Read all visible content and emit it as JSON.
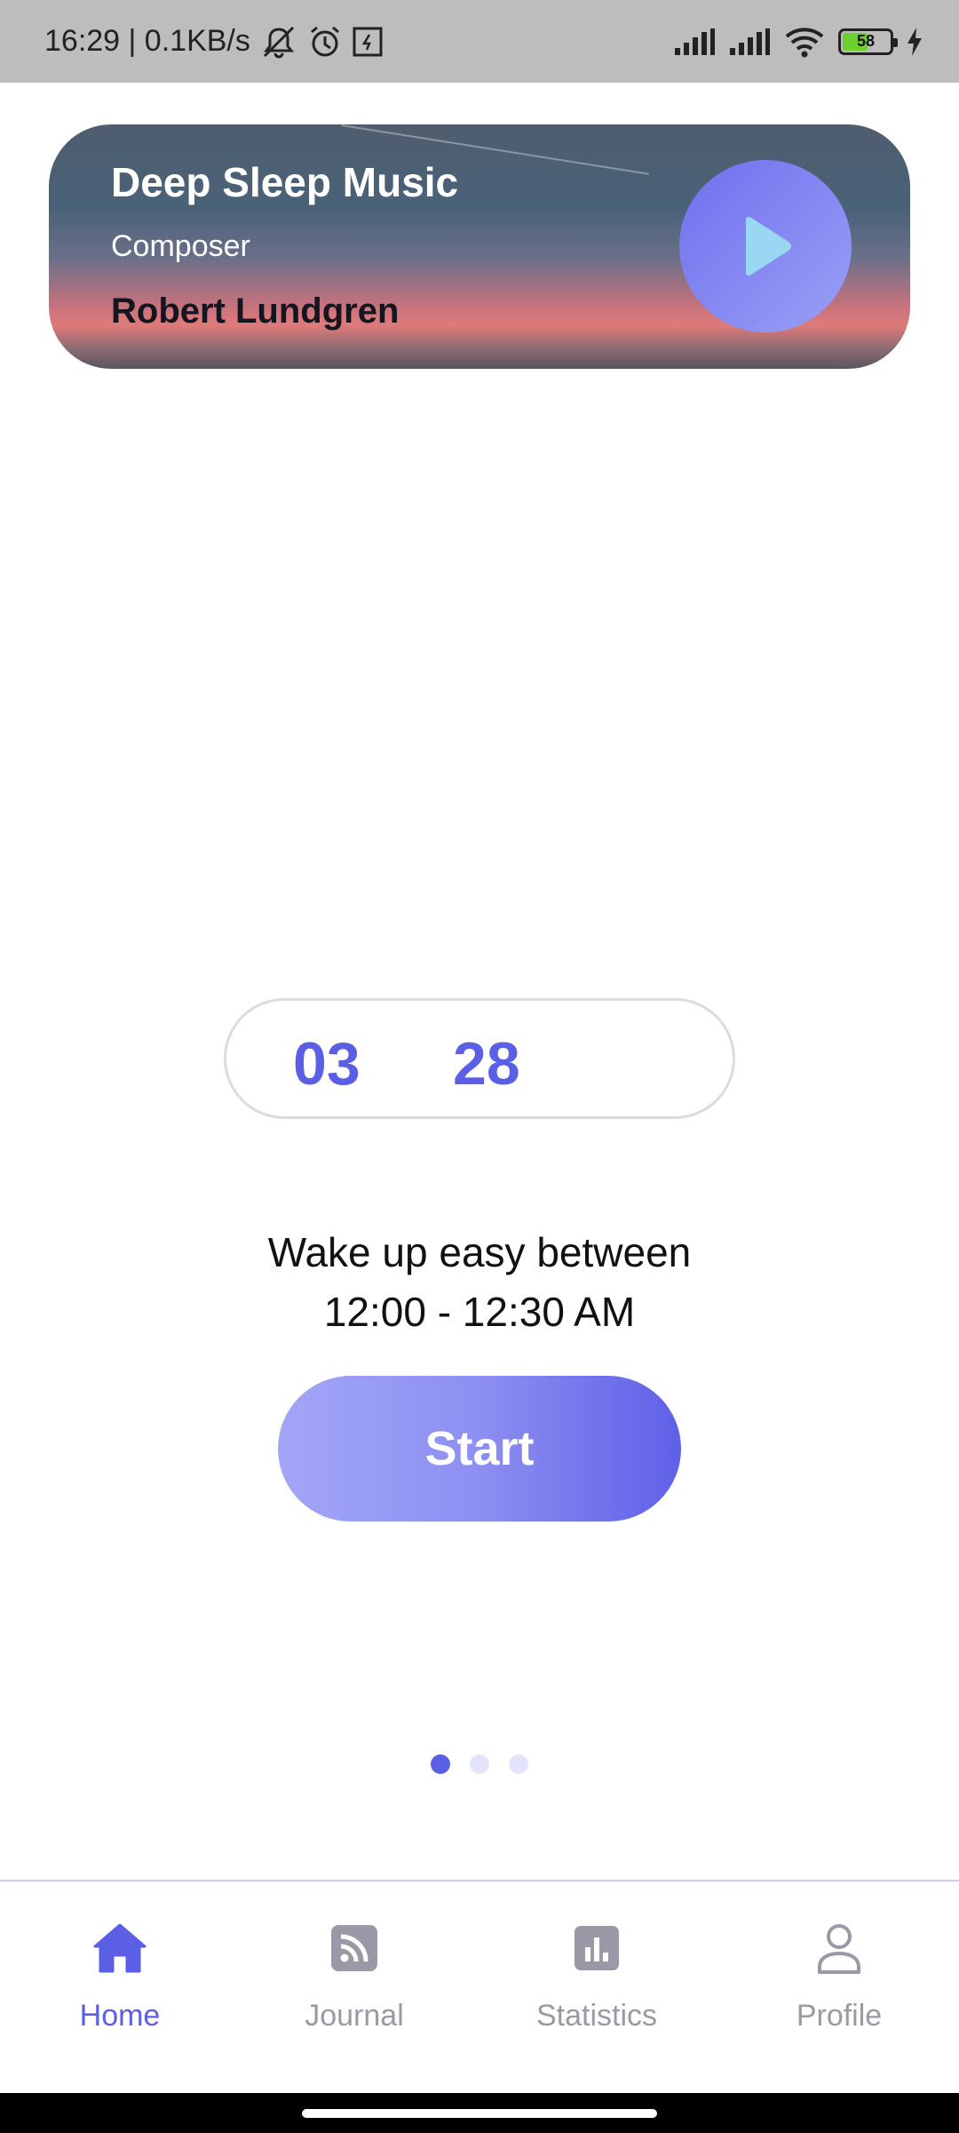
{
  "status_bar": {
    "time_speed": "16:29 | 0.1KB/s",
    "battery_level": "58",
    "icons": [
      "mute-bell-icon",
      "alarm-icon",
      "notification-icon",
      "signal-icon",
      "signal-icon",
      "wifi-icon",
      "battery-icon",
      "charging-icon"
    ]
  },
  "music_card": {
    "title": "Deep Sleep Music",
    "subtitle": "Composer",
    "artist": "Robert Lundgren",
    "play_icon": "play-icon"
  },
  "timer": {
    "hours": "03",
    "minutes": "28"
  },
  "wake": {
    "line1": "Wake up easy between",
    "line2": "12:00 - 12:30 AM"
  },
  "start_label": "Start",
  "pager": {
    "count": 3,
    "active_index": 0
  },
  "nav": {
    "items": [
      {
        "label": "Home",
        "icon": "home-icon",
        "active": true
      },
      {
        "label": "Journal",
        "icon": "rss-icon",
        "active": false
      },
      {
        "label": "Statistics",
        "icon": "bar-chart-icon",
        "active": false
      },
      {
        "label": "Profile",
        "icon": "user-icon",
        "active": false
      }
    ]
  },
  "colors": {
    "accent": "#5b5fe6",
    "inactive": "#9a9aa6"
  }
}
